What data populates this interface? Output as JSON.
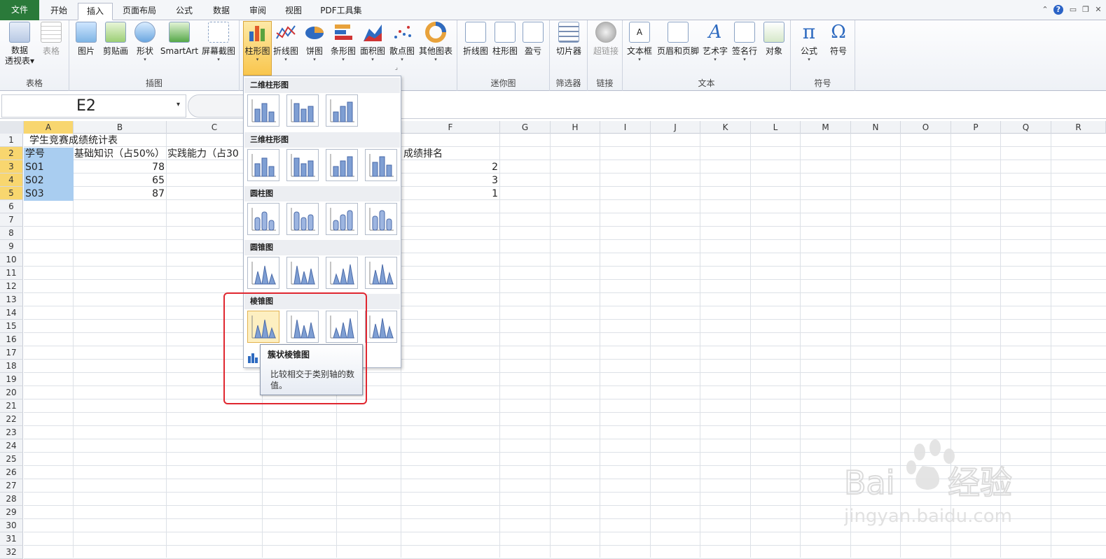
{
  "tabs": [
    "文件",
    "开始",
    "插入",
    "页面布局",
    "公式",
    "数据",
    "审阅",
    "视图",
    "PDF工具集"
  ],
  "ribbon": {
    "groups": {
      "table": {
        "label": "表格",
        "pivot_line1": "数据",
        "pivot_line2": "透视表",
        "table": "表格"
      },
      "illus": {
        "label": "插图",
        "picture": "图片",
        "clipart": "剪贴画",
        "shapes": "形状",
        "smartart": "SmartArt",
        "screenshot": "屏幕截图"
      },
      "charts": {
        "column": "柱形图",
        "line": "折线图",
        "pie": "饼图",
        "bar": "条形图",
        "area": "面积图",
        "scatter": "散点图",
        "other": "其他图表"
      },
      "spark": {
        "label": "迷你图",
        "line": "折线图",
        "column": "柱形图",
        "winloss": "盈亏"
      },
      "filter": {
        "label": "筛选器",
        "slicer": "切片器"
      },
      "links": {
        "label": "链接",
        "hyperlink": "超链接"
      },
      "text": {
        "label": "文本",
        "textbox": "文本框",
        "headerfooter": "页眉和页脚",
        "wordart": "艺术字",
        "sigline": "签名行",
        "object": "对象"
      },
      "symbols": {
        "label": "符号",
        "equation": "公式",
        "symbol": "符号"
      }
    }
  },
  "namebox": "E2",
  "columns": [
    "A",
    "B",
    "C",
    "D",
    "E",
    "F",
    "G",
    "H",
    "I",
    "J",
    "K",
    "L",
    "M",
    "N",
    "O",
    "P",
    "Q",
    "R"
  ],
  "rows": [
    "1",
    "2",
    "3",
    "4",
    "5",
    "6",
    "7",
    "8",
    "9",
    "10",
    "11",
    "12",
    "13",
    "14",
    "15",
    "16",
    "17",
    "18",
    "19",
    "20",
    "21",
    "22",
    "23",
    "24",
    "25",
    "26",
    "27",
    "28",
    "29",
    "30",
    "31",
    "32"
  ],
  "sheet": {
    "title": "学生竞赛成绩统计表",
    "h_a": "学号",
    "h_b": "基础知识（占50%）",
    "h_c": "实践能力（占30",
    "h_f": "成绩排名",
    "r3": {
      "a": "S01",
      "b": "78",
      "f": "2"
    },
    "r4": {
      "a": "S02",
      "b": "65",
      "f": "3"
    },
    "r5": {
      "a": "S03",
      "b": "87",
      "f": "1"
    }
  },
  "gallery": {
    "sections": [
      "二维柱形图",
      "三维柱形图",
      "圆柱图",
      "圆锥图",
      "棱锥图"
    ]
  },
  "tooltip": {
    "title": "簇状棱锥图",
    "desc": "比较相交于类别轴的数值。"
  },
  "watermark": {
    "brand": "Baidu经验",
    "url": "jingyan.baidu.com"
  }
}
